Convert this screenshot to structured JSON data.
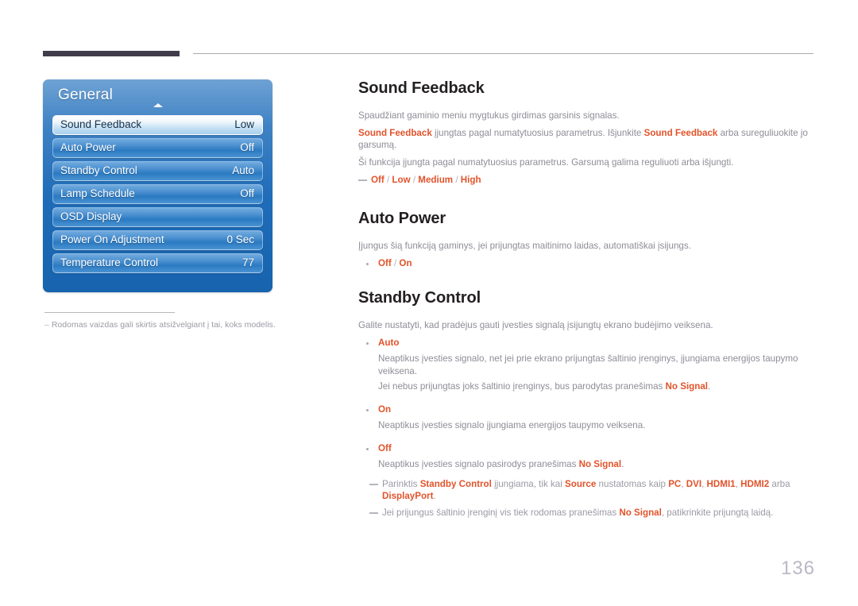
{
  "header": {
    "bar_color": "#413c4a",
    "rule_color": "#a9a9af"
  },
  "osd_menu": {
    "title": "General",
    "arrow_icon": "up-arrow-icon",
    "rows": [
      {
        "label": "Sound Feedback",
        "value": "Low",
        "selected": true
      },
      {
        "label": "Auto Power",
        "value": "Off",
        "selected": false
      },
      {
        "label": "Standby Control",
        "value": "Auto",
        "selected": false
      },
      {
        "label": "Lamp Schedule",
        "value": "Off",
        "selected": false
      },
      {
        "label": "OSD Display",
        "value": "",
        "selected": false
      },
      {
        "label": "Power On Adjustment",
        "value": "0 Sec",
        "selected": false
      },
      {
        "label": "Temperature Control",
        "value": "77",
        "selected": false
      }
    ]
  },
  "figure_note": {
    "dash": "–",
    "text": "Rodomas vaizdas gali skirtis atsižvelgiant į tai, koks modelis."
  },
  "sections": {
    "sound_feedback": {
      "heading": "Sound Feedback",
      "p1": "Spaudžiant gaminio meniu mygtukus girdimas garsinis signalas.",
      "p2_a": "Sound Feedback",
      "p2_b": " įjungtas pagal numatytuosius parametrus. Išjunkite ",
      "p2_c": "Sound Feedback",
      "p2_d": " arba sureguliuokite jo garsumą.",
      "p3": "Ši funkcija įjungta pagal numatytuosius parametrus. Garsumą galima reguliuoti arba išjungti.",
      "options": "Off / Low / Medium / High"
    },
    "auto_power": {
      "heading": "Auto Power",
      "p1": "Įjungus šią funkciją gaminys, jei prijungtas maitinimo laidas, automatiškai įsijungs.",
      "options": "Off / On"
    },
    "standby_control": {
      "heading": "Standby Control",
      "p1": "Galite nustatyti, kad pradėjus gauti įvesties signalą įsijungtų ekrano budėjimo veiksena.",
      "items": [
        {
          "label": "Auto",
          "lines": [
            {
              "pre": "Neaptikus įvesties signalo, net jei prie ekrano prijungtas šaltinio įrenginys, įjungiama energijos taupymo veiksena.",
              "em": "",
              "post": ""
            },
            {
              "pre": "Jei nebus prijungtas joks šaltinio įrenginys, bus parodytas pranešimas ",
              "em": "No Signal",
              "post": "."
            }
          ]
        },
        {
          "label": "On",
          "lines": [
            {
              "pre": "Neaptikus įvesties signalo įjungiama energijos taupymo veiksena.",
              "em": "",
              "post": ""
            }
          ]
        },
        {
          "label": "Off",
          "lines": [
            {
              "pre": "Neaptikus įvesties signalo pasirodys pranešimas ",
              "em": "No Signal",
              "post": "."
            }
          ]
        }
      ],
      "note1": {
        "t1": "Parinktis ",
        "e1": "Standby Control",
        "t2": " įjungiama, tik kai ",
        "e2": "Source",
        "t3": " nustatomas kaip ",
        "e3": "PC",
        "t4": ", ",
        "e4": "DVI",
        "t5": ", ",
        "e5": "HDMI1",
        "t6": ", ",
        "e6": "HDMI2",
        "t7": " arba ",
        "e7": "DisplayPort",
        "t8": "."
      },
      "note2": {
        "t1": "Jei prijungus šaltinio įrenginį vis tiek rodomas pranešimas ",
        "e1": "No Signal",
        "t2": ", patikrinkite prijungtą laidą."
      }
    }
  },
  "page_number": "136",
  "colors": {
    "accent_orange": "#e2532b",
    "body_gray": "#8d8d97",
    "heading_dark": "#231f20",
    "osd_blue": "#1f6cb8"
  }
}
